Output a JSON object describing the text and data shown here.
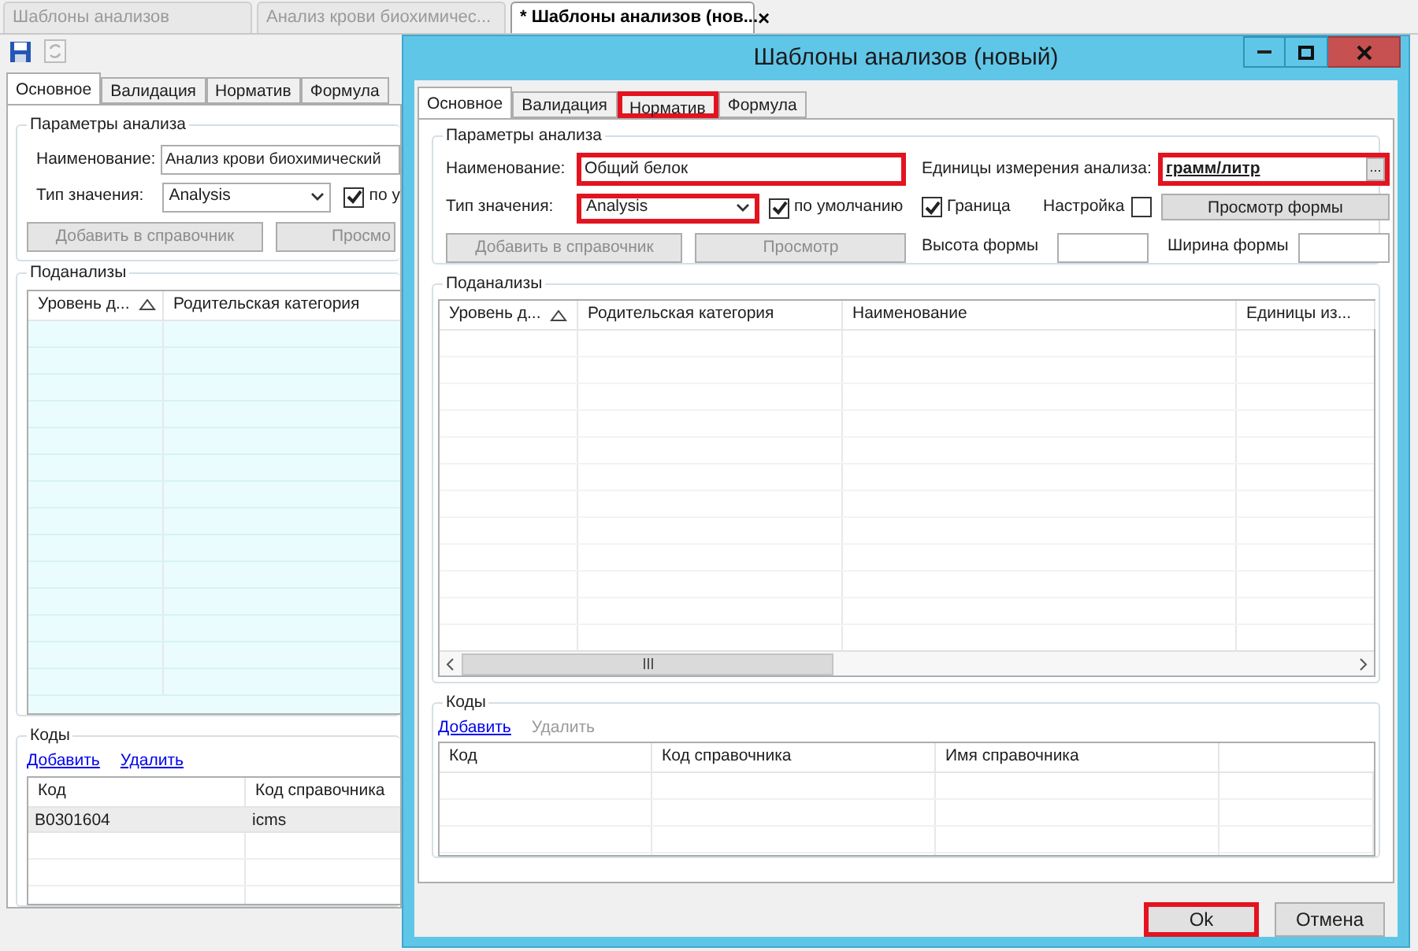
{
  "doc_tabs": [
    {
      "label": "Шаблоны анализов",
      "selected": false
    },
    {
      "label": "Анализ крови биохимичес...",
      "selected": false
    },
    {
      "label": "* Шаблоны анализов (нов...",
      "selected": true,
      "close": "×"
    }
  ],
  "background": {
    "tabs": [
      {
        "label": "Основное",
        "selected": true
      },
      {
        "label": "Валидация",
        "selected": false
      },
      {
        "label": "Норматив",
        "selected": false
      },
      {
        "label": "Формула",
        "selected": false
      }
    ],
    "params": {
      "title": "Параметры анализа",
      "name_label": "Наименование:",
      "name_value": "Анализ крови биохимический",
      "type_label": "Тип значения:",
      "type_value": "Analysis",
      "default_checked": true,
      "default_label": "по у",
      "buttons": [
        {
          "label": "Добавить в справочник",
          "disabled": true
        },
        {
          "label": "Просмо",
          "disabled": true
        }
      ]
    },
    "subanalyses": {
      "title": "Поданализы",
      "columns": [
        "Уровень д...",
        "Родительская категория"
      ]
    },
    "codes": {
      "title": "Коды",
      "links": [
        {
          "label": "Добавить",
          "disabled": false
        },
        {
          "label": "Удалить",
          "disabled": false
        }
      ],
      "columns": [
        "Код",
        "Код справочника"
      ],
      "rows": [
        [
          "B0301604",
          "icms"
        ]
      ]
    }
  },
  "dialog": {
    "title": "Шаблоны анализов (новый)",
    "tabs": [
      {
        "label": "Основное",
        "selected": true,
        "highlighted": false
      },
      {
        "label": "Валидация",
        "selected": false,
        "highlighted": false
      },
      {
        "label": "Норматив",
        "selected": false,
        "highlighted": true
      },
      {
        "label": "Формула",
        "selected": false,
        "highlighted": false
      }
    ],
    "params": {
      "title": "Параметры анализа",
      "name_label": "Наименование:",
      "name_value": "Общий белок",
      "name_highlighted": true,
      "type_label": "Тип значения:",
      "type_value": "Analysis",
      "type_highlighted": true,
      "default_checked": true,
      "default_label": "по умолчанию",
      "buttons": [
        {
          "label": "Добавить в справочник",
          "disabled": true
        },
        {
          "label": "Просмотр",
          "disabled": true
        }
      ],
      "units_label": "Единицы измерения анализа:",
      "units_value": "грамм/литр",
      "units_button": "...",
      "units_highlighted": true,
      "border_checked": true,
      "border_label": "Граница",
      "setting_label": "Настройка",
      "setting_checked": false,
      "preview_button": "Просмотр формы",
      "height_label": "Высота формы",
      "width_label": "Ширина формы"
    },
    "subanalyses": {
      "title": "Поданализы",
      "columns": [
        "Уровень д...",
        "Родительская категория",
        "Наименование",
        "Единицы из..."
      ]
    },
    "codes": {
      "title": "Коды",
      "links": [
        {
          "label": "Добавить",
          "disabled": false
        },
        {
          "label": "Удалить",
          "disabled": true
        }
      ],
      "columns": [
        "Код",
        "Код справочника",
        "Имя справочника"
      ]
    },
    "buttons": [
      {
        "label": "Ok",
        "highlighted": true
      },
      {
        "label": "Отмена",
        "highlighted": false
      }
    ]
  }
}
